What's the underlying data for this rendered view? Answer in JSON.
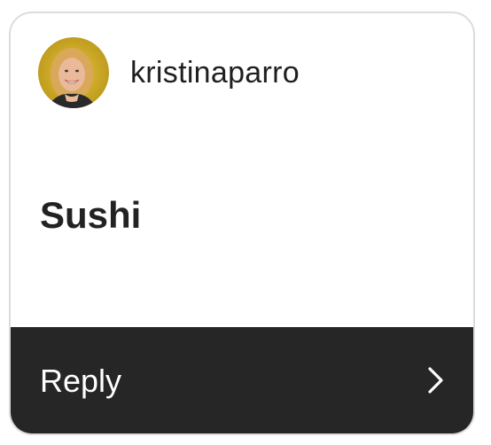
{
  "profile": {
    "username": "kristinaparro",
    "avatar_icon": "profile-photo"
  },
  "message": {
    "text": "Sushi"
  },
  "footer": {
    "reply_label": "Reply",
    "chevron_icon": "chevron-right-icon"
  },
  "colors": {
    "card_border": "#dcdcdc",
    "footer_bg": "#262626",
    "text_dark": "#222222",
    "text_light": "#ffffff"
  }
}
